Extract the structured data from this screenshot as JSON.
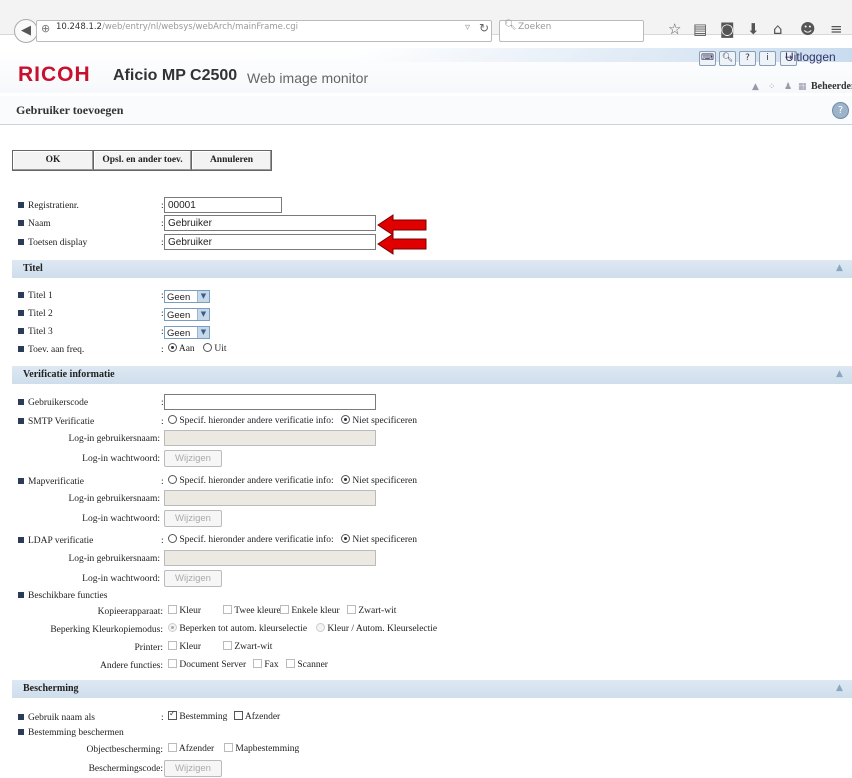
{
  "browser": {
    "url_host": "10.248.1.2",
    "url_path": "/web/entry/nl/websys/webArch/mainFrame.cgi",
    "search_placeholder": "Zoeken"
  },
  "header": {
    "brand": "RICOH",
    "model": "Aficio MP C2500",
    "subtitle": "Web image monitor",
    "logout_label": "Uitloggen",
    "user": "Beheerder"
  },
  "page": {
    "title": "Gebruiker toevoegen",
    "buttons": {
      "ok": "OK",
      "save_add": "Opsl. en ander toev.",
      "cancel": "Annuleren"
    }
  },
  "fields": {
    "reg_no": {
      "label": "Registratienr.",
      "value": "00001"
    },
    "name": {
      "label": "Naam",
      "value": "Gebruiker"
    },
    "key_display": {
      "label": "Toetsen display",
      "value": "Gebruiker"
    }
  },
  "sections": {
    "titel": "Titel",
    "verificatie": "Verificatie informatie",
    "bescherming": "Bescherming"
  },
  "titel": {
    "titel1": {
      "label": "Titel 1",
      "value": "Geen"
    },
    "titel2": {
      "label": "Titel 2",
      "value": "Geen"
    },
    "titel3": {
      "label": "Titel 3",
      "value": "Geen"
    },
    "freq": {
      "label": "Toev. aan freq.",
      "on": "Aan",
      "off": "Uit",
      "selected": "Aan"
    }
  },
  "verif": {
    "user_code_label": "Gebruikerscode",
    "smtp_label": "SMTP Verificatie",
    "map_label": "Mapverificatie",
    "ldap_label": "LDAP verificatie",
    "specify_opt": "Specif. hieronder andere verificatie info:",
    "not_specify_opt": "Niet specificeren",
    "login_user_label": "Log-in gebruikersnaam:",
    "login_pw_label": "Log-in wachtwoord:",
    "change_btn": "Wijzigen"
  },
  "functions": {
    "label": "Beschikbare functies",
    "copier_label": "Kopieerapparaat:",
    "copier_opts": [
      "Kleur",
      "Twee kleuren",
      "Enkele kleur",
      "Zwart-wit"
    ],
    "color_limit_label": "Beperking Kleurkopiemodus:",
    "color_limit_opts": [
      "Beperken tot autom. kleurselectie",
      "Kleur / Autom. Kleurselectie"
    ],
    "printer_label": "Printer:",
    "printer_opts": [
      "Kleur",
      "Zwart-wit"
    ],
    "other_label": "Andere functies:",
    "other_opts": [
      "Document Server",
      "Fax",
      "Scanner"
    ]
  },
  "protection": {
    "use_name_label": "Gebruik naam als",
    "use_name_opts": [
      "Bestemming",
      "Afzender"
    ],
    "protect_dest_label": "Bestemming beschermen",
    "object_label": "Objectbescherming:",
    "object_opts": [
      "Afzender",
      "Mapbestemming"
    ],
    "code_label": "Beschermingscode:",
    "code_btn": "Wijzigen"
  },
  "colors": {
    "brand": "#c8102e",
    "section": "#d6e3f0",
    "arrow": "#e00000"
  }
}
